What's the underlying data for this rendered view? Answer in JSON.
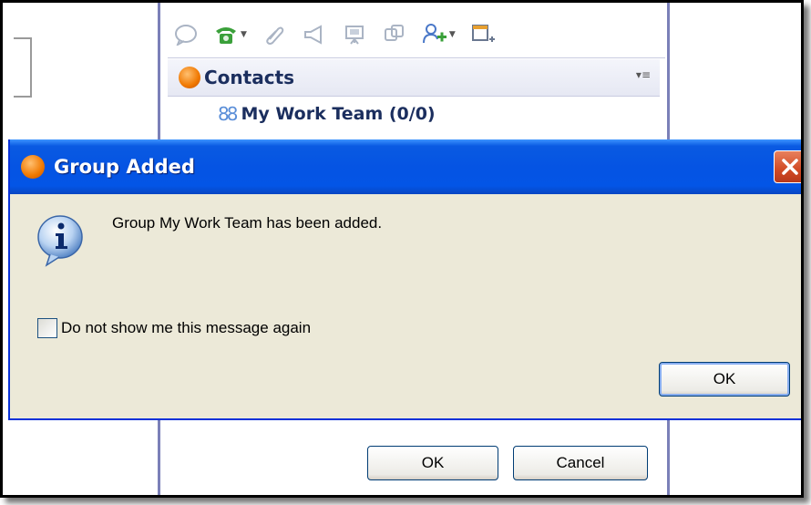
{
  "background": {
    "toolbar_icons": [
      "chat-bubble-icon",
      "phone-icon",
      "paperclip-icon",
      "megaphone-icon",
      "presentation-icon",
      "share-icon",
      "add-contact-icon",
      "new-window-icon"
    ],
    "contacts": {
      "title": "Contacts",
      "group_label": "My Work Team (0/0)"
    },
    "buttons": {
      "ok_label": "OK",
      "cancel_label": "Cancel"
    }
  },
  "dialog": {
    "title": "Group Added",
    "message": "Group My Work Team has been added.",
    "checkbox_label": "Do not show me this message again",
    "checkbox_checked": false,
    "ok_label": "OK"
  },
  "colors": {
    "titlebar": "#0554e3",
    "dialog_bg": "#ece9d8",
    "close_button": "#d14a24",
    "brand_orange": "#f07800",
    "contacts_text": "#1b2e5e"
  }
}
